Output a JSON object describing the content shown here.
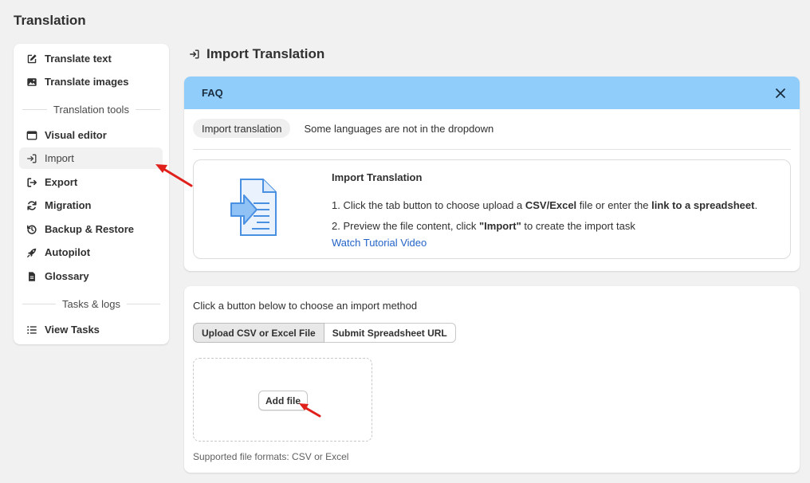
{
  "page": {
    "title": "Translation"
  },
  "sidebar": {
    "items_top": [
      {
        "label": "Translate text",
        "icon": "edit-icon"
      },
      {
        "label": "Translate images",
        "icon": "image-icon"
      }
    ],
    "section_tools": "Translation tools",
    "items_tools": [
      {
        "label": "Visual editor",
        "icon": "browser-window-icon"
      },
      {
        "label": "Import",
        "icon": "import-icon",
        "active": true
      },
      {
        "label": "Export",
        "icon": "export-icon"
      },
      {
        "label": "Migration",
        "icon": "refresh-icon"
      },
      {
        "label": "Backup & Restore",
        "icon": "history-icon"
      },
      {
        "label": "Autopilot",
        "icon": "rocket-icon"
      },
      {
        "label": "Glossary",
        "icon": "document-icon"
      }
    ],
    "section_tasks": "Tasks & logs",
    "items_tasks": [
      {
        "label": "View Tasks",
        "icon": "list-icon"
      }
    ]
  },
  "main": {
    "title": "Import Translation"
  },
  "faq": {
    "title": "FAQ",
    "tabs": [
      "Import translation",
      "Some languages are not in the dropdown"
    ],
    "box": {
      "title": "Import Translation",
      "step1": {
        "num": "1.",
        "a": "Click the tab button to choose upload a ",
        "b": "CSV/Excel",
        "c": " file or enter the ",
        "d": "link to a spreadsheet",
        "e": "."
      },
      "step2": {
        "num": "2.",
        "a": "Preview the file content, click ",
        "b": "\"Import\"",
        "c": " to create the import task"
      },
      "link": "Watch Tutorial Video"
    }
  },
  "upload": {
    "instruction": "Click a button below to choose an import method",
    "methods": [
      "Upload CSV or Excel File",
      "Submit Spreadsheet URL"
    ],
    "add_file": "Add file",
    "formats": "Supported file formats: CSV or Excel"
  },
  "colors": {
    "faq_header": "#91cdfb",
    "link": "#2463c7",
    "annotation_arrow": "#e0201b",
    "illustration": "#4a90e2"
  }
}
